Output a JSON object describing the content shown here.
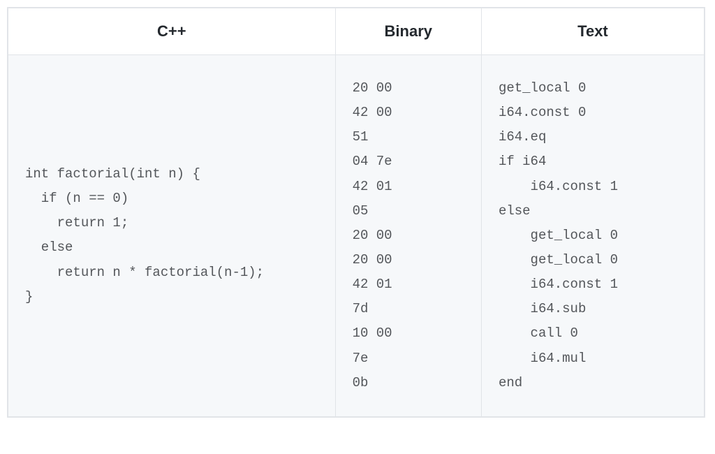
{
  "headers": {
    "cpp": "C++",
    "binary": "Binary",
    "text": "Text"
  },
  "code": {
    "cpp": "int factorial(int n) {\n  if (n == 0)\n    return 1;\n  else\n    return n * factorial(n-1);\n}",
    "binary": "20 00\n42 00\n51\n04 7e\n42 01\n05\n20 00\n20 00\n42 01\n7d\n10 00\n7e\n0b",
    "text": "get_local 0\ni64.const 0\ni64.eq\nif i64\n    i64.const 1\nelse\n    get_local 0\n    get_local 0\n    i64.const 1\n    i64.sub\n    call 0\n    i64.mul\nend"
  }
}
